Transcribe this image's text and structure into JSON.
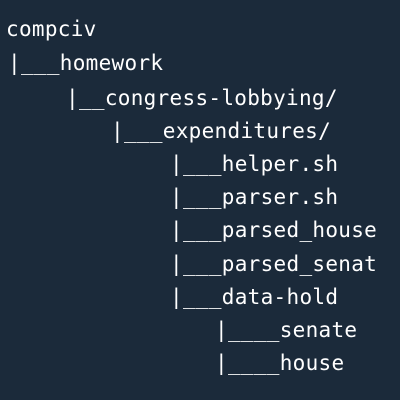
{
  "tree": {
    "root": "compciv",
    "items": [
      {
        "prefix": "|___",
        "name": "homework"
      },
      {
        "prefix": "|__",
        "name": "congress-lobbying/"
      },
      {
        "prefix": "|___",
        "name": "expenditures/"
      },
      {
        "prefix": "|___",
        "name": "helper.sh"
      },
      {
        "prefix": "|___",
        "name": "parser.sh"
      },
      {
        "prefix": "|___",
        "name": "parsed_house"
      },
      {
        "prefix": "|___",
        "name": "parsed_senat"
      },
      {
        "prefix": "|___",
        "name": "data-hold"
      },
      {
        "prefix": "|____",
        "name": "senate"
      },
      {
        "prefix": "|____",
        "name": "house"
      }
    ]
  },
  "colors": {
    "background": "#1b2a3a",
    "text": "#ffffff"
  }
}
